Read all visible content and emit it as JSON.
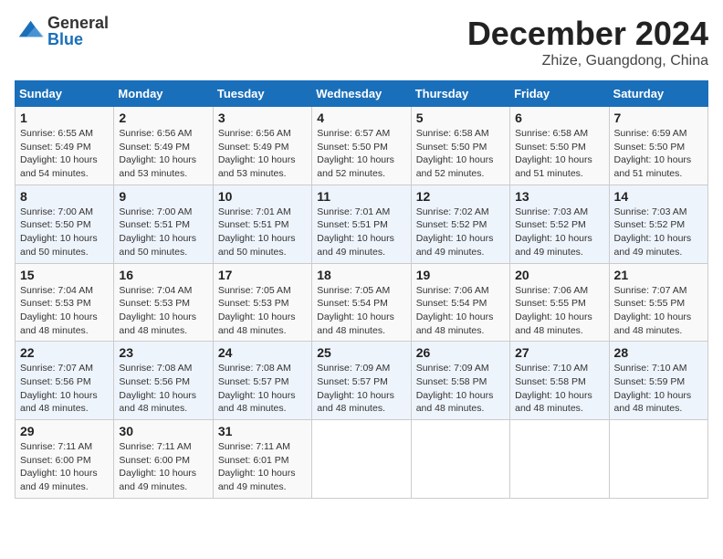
{
  "logo": {
    "general": "General",
    "blue": "Blue"
  },
  "header": {
    "month": "December 2024",
    "location": "Zhize, Guangdong, China"
  },
  "weekdays": [
    "Sunday",
    "Monday",
    "Tuesday",
    "Wednesday",
    "Thursday",
    "Friday",
    "Saturday"
  ],
  "weeks": [
    [
      {
        "day": "1",
        "sunrise": "6:55 AM",
        "sunset": "5:49 PM",
        "daylight": "10 hours and 54 minutes."
      },
      {
        "day": "2",
        "sunrise": "6:56 AM",
        "sunset": "5:49 PM",
        "daylight": "10 hours and 53 minutes."
      },
      {
        "day": "3",
        "sunrise": "6:56 AM",
        "sunset": "5:49 PM",
        "daylight": "10 hours and 53 minutes."
      },
      {
        "day": "4",
        "sunrise": "6:57 AM",
        "sunset": "5:50 PM",
        "daylight": "10 hours and 52 minutes."
      },
      {
        "day": "5",
        "sunrise": "6:58 AM",
        "sunset": "5:50 PM",
        "daylight": "10 hours and 52 minutes."
      },
      {
        "day": "6",
        "sunrise": "6:58 AM",
        "sunset": "5:50 PM",
        "daylight": "10 hours and 51 minutes."
      },
      {
        "day": "7",
        "sunrise": "6:59 AM",
        "sunset": "5:50 PM",
        "daylight": "10 hours and 51 minutes."
      }
    ],
    [
      {
        "day": "8",
        "sunrise": "7:00 AM",
        "sunset": "5:50 PM",
        "daylight": "10 hours and 50 minutes."
      },
      {
        "day": "9",
        "sunrise": "7:00 AM",
        "sunset": "5:51 PM",
        "daylight": "10 hours and 50 minutes."
      },
      {
        "day": "10",
        "sunrise": "7:01 AM",
        "sunset": "5:51 PM",
        "daylight": "10 hours and 50 minutes."
      },
      {
        "day": "11",
        "sunrise": "7:01 AM",
        "sunset": "5:51 PM",
        "daylight": "10 hours and 49 minutes."
      },
      {
        "day": "12",
        "sunrise": "7:02 AM",
        "sunset": "5:52 PM",
        "daylight": "10 hours and 49 minutes."
      },
      {
        "day": "13",
        "sunrise": "7:03 AM",
        "sunset": "5:52 PM",
        "daylight": "10 hours and 49 minutes."
      },
      {
        "day": "14",
        "sunrise": "7:03 AM",
        "sunset": "5:52 PM",
        "daylight": "10 hours and 49 minutes."
      }
    ],
    [
      {
        "day": "15",
        "sunrise": "7:04 AM",
        "sunset": "5:53 PM",
        "daylight": "10 hours and 48 minutes."
      },
      {
        "day": "16",
        "sunrise": "7:04 AM",
        "sunset": "5:53 PM",
        "daylight": "10 hours and 48 minutes."
      },
      {
        "day": "17",
        "sunrise": "7:05 AM",
        "sunset": "5:53 PM",
        "daylight": "10 hours and 48 minutes."
      },
      {
        "day": "18",
        "sunrise": "7:05 AM",
        "sunset": "5:54 PM",
        "daylight": "10 hours and 48 minutes."
      },
      {
        "day": "19",
        "sunrise": "7:06 AM",
        "sunset": "5:54 PM",
        "daylight": "10 hours and 48 minutes."
      },
      {
        "day": "20",
        "sunrise": "7:06 AM",
        "sunset": "5:55 PM",
        "daylight": "10 hours and 48 minutes."
      },
      {
        "day": "21",
        "sunrise": "7:07 AM",
        "sunset": "5:55 PM",
        "daylight": "10 hours and 48 minutes."
      }
    ],
    [
      {
        "day": "22",
        "sunrise": "7:07 AM",
        "sunset": "5:56 PM",
        "daylight": "10 hours and 48 minutes."
      },
      {
        "day": "23",
        "sunrise": "7:08 AM",
        "sunset": "5:56 PM",
        "daylight": "10 hours and 48 minutes."
      },
      {
        "day": "24",
        "sunrise": "7:08 AM",
        "sunset": "5:57 PM",
        "daylight": "10 hours and 48 minutes."
      },
      {
        "day": "25",
        "sunrise": "7:09 AM",
        "sunset": "5:57 PM",
        "daylight": "10 hours and 48 minutes."
      },
      {
        "day": "26",
        "sunrise": "7:09 AM",
        "sunset": "5:58 PM",
        "daylight": "10 hours and 48 minutes."
      },
      {
        "day": "27",
        "sunrise": "7:10 AM",
        "sunset": "5:58 PM",
        "daylight": "10 hours and 48 minutes."
      },
      {
        "day": "28",
        "sunrise": "7:10 AM",
        "sunset": "5:59 PM",
        "daylight": "10 hours and 48 minutes."
      }
    ],
    [
      {
        "day": "29",
        "sunrise": "7:11 AM",
        "sunset": "6:00 PM",
        "daylight": "10 hours and 49 minutes."
      },
      {
        "day": "30",
        "sunrise": "7:11 AM",
        "sunset": "6:00 PM",
        "daylight": "10 hours and 49 minutes."
      },
      {
        "day": "31",
        "sunrise": "7:11 AM",
        "sunset": "6:01 PM",
        "daylight": "10 hours and 49 minutes."
      },
      null,
      null,
      null,
      null
    ]
  ]
}
